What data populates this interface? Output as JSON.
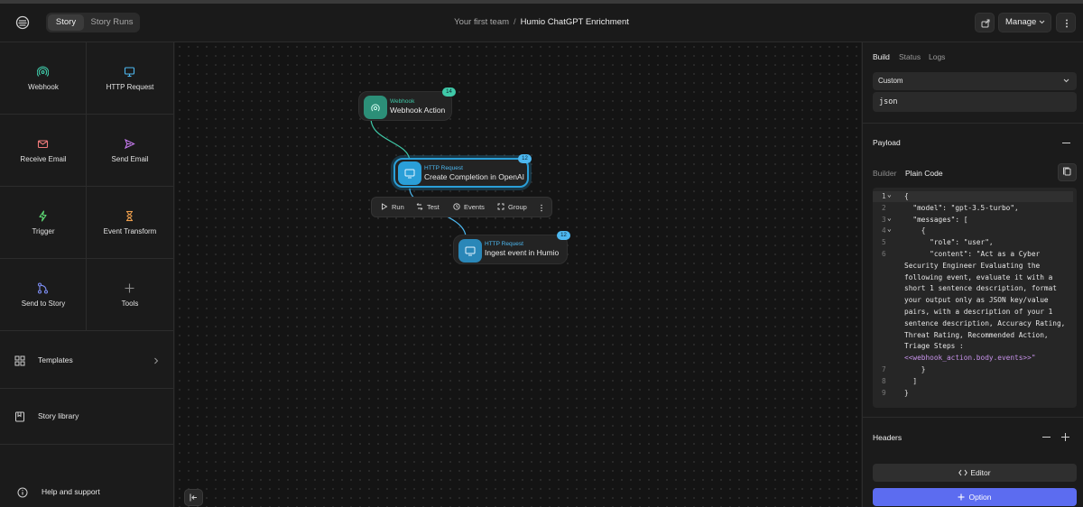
{
  "header": {
    "tabs": [
      {
        "label": "Story",
        "active": true
      },
      {
        "label": "Story Runs",
        "active": false
      }
    ],
    "breadcrumb": {
      "team": "Your first team",
      "separator": "/",
      "story": "Humio ChatGPT Enrichment"
    },
    "manage_label": "Manage"
  },
  "sidebar": {
    "tiles": [
      {
        "label": "Webhook",
        "icon": "webhook-icon",
        "color": "#3fc9a8"
      },
      {
        "label": "HTTP Request",
        "icon": "monitor-icon",
        "color": "#4db8f0"
      },
      {
        "label": "Receive Email",
        "icon": "mail-icon",
        "color": "#f07a7a"
      },
      {
        "label": "Send Email",
        "icon": "send-icon",
        "color": "#c77bf0"
      },
      {
        "label": "Trigger",
        "icon": "bolt-icon",
        "color": "#5cd672"
      },
      {
        "label": "Event Transform",
        "icon": "hourglass-icon",
        "color": "#f0a04d"
      },
      {
        "label": "Send to Story",
        "icon": "git-merge-icon",
        "color": "#7b8cf0"
      },
      {
        "label": "Tools",
        "icon": "plus-icon",
        "color": "#8a8a8a"
      }
    ],
    "rows": [
      {
        "label": "Templates",
        "icon": "grid-icon"
      },
      {
        "label": "Story library",
        "icon": "book-icon"
      },
      {
        "label": "Help and support",
        "icon": "help-icon"
      }
    ]
  },
  "canvas": {
    "nodes": [
      {
        "type": "Webhook",
        "name": "Webhook Action",
        "badge": "14",
        "color": "#3fc9a8"
      },
      {
        "type": "HTTP Request",
        "name": "Create Completion in OpenAI",
        "badge": "12",
        "color": "#4db8f0"
      },
      {
        "type": "HTTP Request",
        "name": "Ingest event in Humio",
        "badge": "12",
        "color": "#4db8f0"
      }
    ],
    "toolbar": [
      {
        "label": "Run",
        "icon": "play-icon"
      },
      {
        "label": "Test",
        "icon": "test-icon"
      },
      {
        "label": "Events",
        "icon": "events-icon"
      },
      {
        "label": "Group",
        "icon": "group-icon"
      }
    ]
  },
  "panel": {
    "tabs": [
      {
        "label": "Build",
        "active": true
      },
      {
        "label": "Status",
        "active": false
      },
      {
        "label": "Logs",
        "active": false
      }
    ],
    "select_value": "Custom",
    "content_type": "json",
    "payload_label": "Payload",
    "payload_tabs": [
      {
        "label": "Builder",
        "active": false
      },
      {
        "label": "Plain Code",
        "active": true
      }
    ],
    "code_lines": [
      {
        "n": "1",
        "fold": true,
        "text": "{",
        "purple": false
      },
      {
        "n": "2",
        "fold": false,
        "text": "  \"model\": \"gpt-3.5-turbo\",",
        "purple": false
      },
      {
        "n": "3",
        "fold": true,
        "text": "  \"messages\": [",
        "purple": false
      },
      {
        "n": "4",
        "fold": true,
        "text": "    {",
        "purple": false
      },
      {
        "n": "5",
        "fold": false,
        "text": "      \"role\": \"user\",",
        "purple": false
      },
      {
        "n": "6",
        "fold": false,
        "text": "      \"content\": \"Act as a Cyber",
        "purple": false
      },
      {
        "n": "",
        "fold": false,
        "text": "Security Engineer Evaluating the",
        "purple": false
      },
      {
        "n": "",
        "fold": false,
        "text": "following event, evaluate it with a",
        "purple": false
      },
      {
        "n": "",
        "fold": false,
        "text": "short 1 sentence description, format",
        "purple": false
      },
      {
        "n": "",
        "fold": false,
        "text": "your output only as JSON key/value",
        "purple": false
      },
      {
        "n": "",
        "fold": false,
        "text": "pairs, with a description of your 1",
        "purple": false
      },
      {
        "n": "",
        "fold": false,
        "text": "sentence description, Accuracy Rating,",
        "purple": false
      },
      {
        "n": "",
        "fold": false,
        "text": "Threat Rating, Recommended Action,",
        "purple": false
      },
      {
        "n": "",
        "fold": false,
        "text": "Triage Steps :",
        "purple": false
      },
      {
        "n": "",
        "fold": false,
        "text": "<<webhook_action.body.events>>\"",
        "purple": true
      },
      {
        "n": "7",
        "fold": false,
        "text": "    }",
        "purple": false
      },
      {
        "n": "8",
        "fold": false,
        "text": "  ]",
        "purple": false
      },
      {
        "n": "9",
        "fold": false,
        "text": "}",
        "purple": false
      }
    ],
    "headers_label": "Headers",
    "editor_label": "Editor",
    "option_label": "Option"
  }
}
